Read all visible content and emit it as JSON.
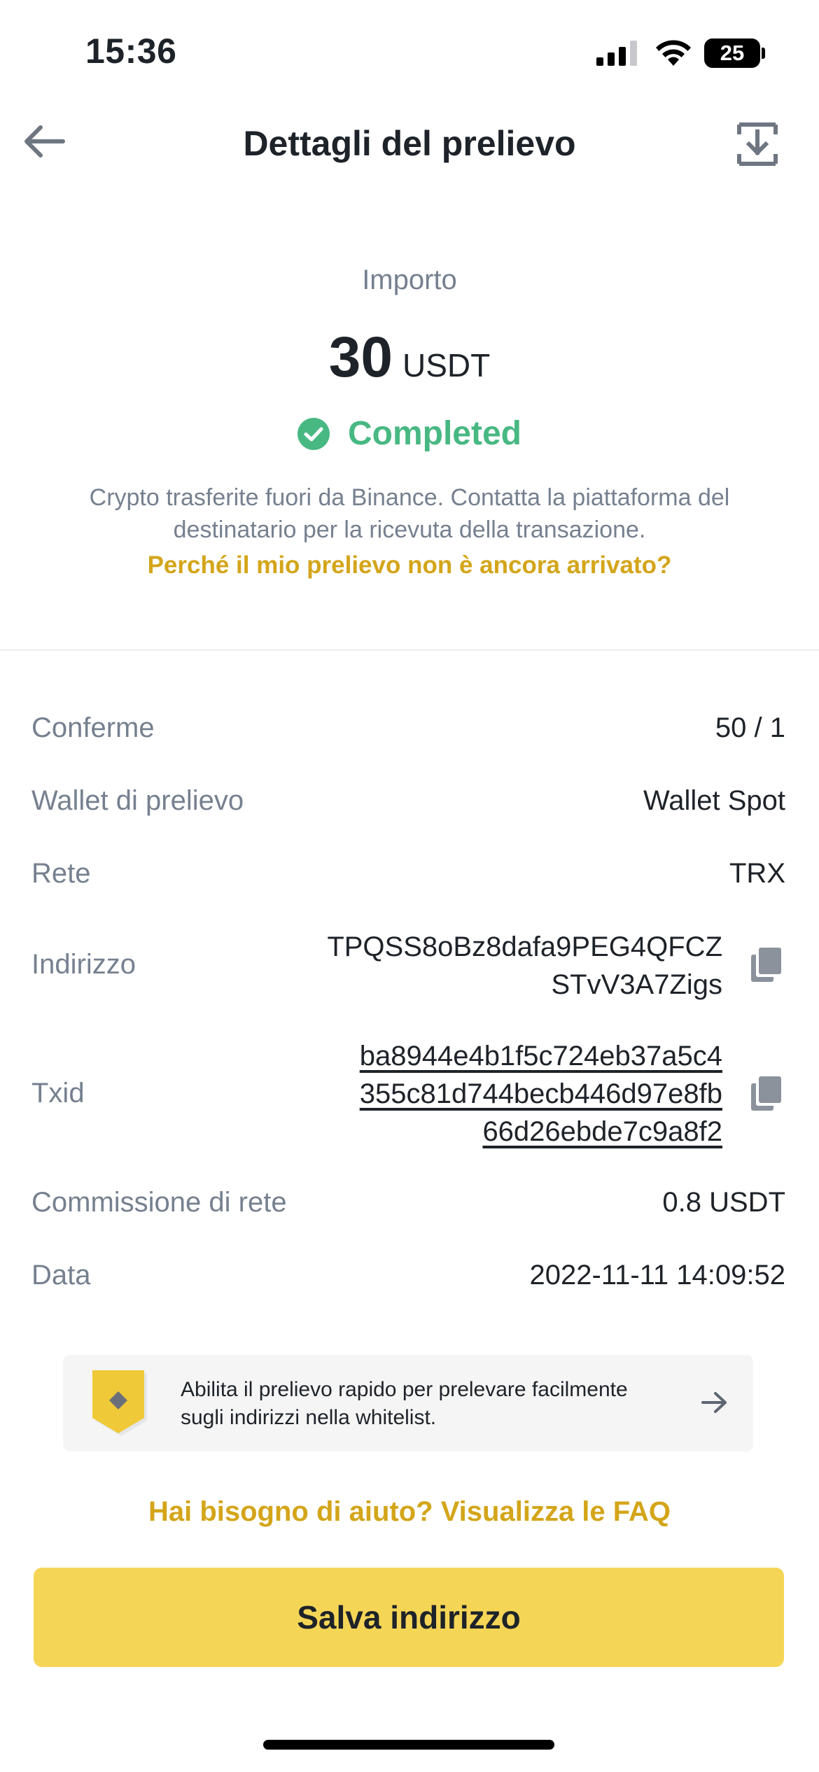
{
  "status_bar": {
    "time": "15:36",
    "battery": "25"
  },
  "header": {
    "title": "Dettagli del prelievo"
  },
  "amount": {
    "label": "Importo",
    "value": "30",
    "unit": "USDT",
    "status": "Completed",
    "status_color": "#48b883",
    "description": "Crypto trasferite fuori da Binance. Contatta la piattaforma del destinatario per la ricevuta della transazione.",
    "why_link": "Perché il mio prelievo non è ancora arrivato?"
  },
  "details": {
    "confirmations": {
      "label": "Conferme",
      "value": "50 / 1"
    },
    "wallet": {
      "label": "Wallet di prelievo",
      "value": "Wallet Spot"
    },
    "network": {
      "label": "Rete",
      "value": "TRX"
    },
    "address": {
      "label": "Indirizzo",
      "line1": "TPQSS8oBz8dafa9PEG4QFCZ",
      "line2": "STvV3A7Zigs"
    },
    "txid": {
      "label": "Txid",
      "line1": "ba8944e4b1f5c724eb37a5c4",
      "line2": "355c81d744becb446d97e8fb",
      "line3": "66d26ebde7c9a8f2"
    },
    "fee": {
      "label": "Commissione di rete",
      "value": "0.8 USDT"
    },
    "date": {
      "label": "Data",
      "value": "2022-11-11 14:09:52"
    }
  },
  "banner": {
    "text": "Abilita il prelievo rapido per prelevare facilmente sugli indirizzi nella whitelist."
  },
  "help": {
    "faq_link": "Hai bisogno di aiuto? Visualizza le FAQ"
  },
  "actions": {
    "save_label": "Salva indirizzo"
  },
  "colors": {
    "accent_yellow": "#f5d556",
    "link_gold": "#d4a51a",
    "muted": "#76808f",
    "text": "#1e2329"
  }
}
